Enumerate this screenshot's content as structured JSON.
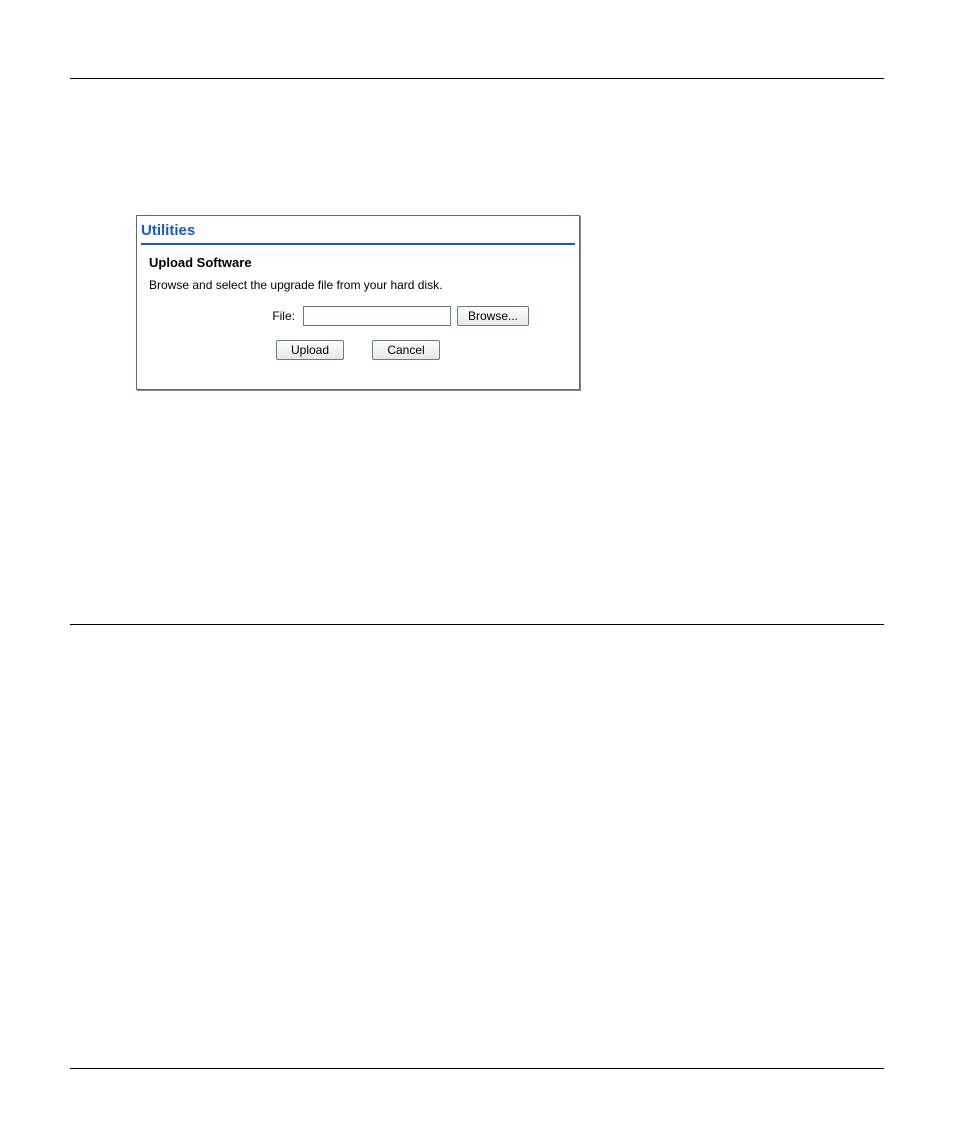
{
  "panel": {
    "title": "Utilities",
    "section_title": "Upload Software",
    "description": "Browse and select the upgrade file from your hard disk.",
    "file_label": "File:",
    "file_value": "",
    "browse_label": "Browse...",
    "upload_label": "Upload",
    "cancel_label": "Cancel"
  }
}
